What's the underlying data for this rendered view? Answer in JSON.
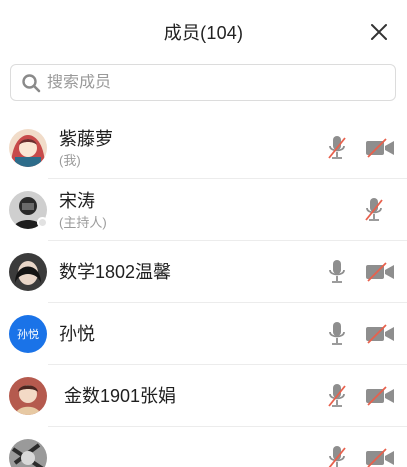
{
  "header": {
    "title": "成员(104)"
  },
  "search": {
    "placeholder": "搜索成员"
  },
  "icons": {
    "close": "close-icon",
    "search": "search-icon",
    "mic": "microphone-icon",
    "cam": "camera-icon"
  },
  "colors": {
    "muted_slash": "#e8604c",
    "icon_gray": "#8e8e8e",
    "text_avatar_bg": "#1a73e8"
  },
  "members": [
    {
      "name": "紫藤萝",
      "tag": "(我)",
      "mic_muted": true,
      "cam_off": true
    },
    {
      "name": "宋涛",
      "tag": "(主持人)",
      "mic_muted": true,
      "cam_off": null
    },
    {
      "name": "数学1802温馨",
      "tag": "",
      "mic_muted": false,
      "cam_off": true
    },
    {
      "name": "孙悦",
      "tag": "",
      "avatar_text": "孙悦",
      "mic_muted": false,
      "cam_off": true
    },
    {
      "name": "金数1901张娟",
      "tag": "",
      "mic_muted": true,
      "cam_off": true
    },
    {
      "name": "",
      "tag": "",
      "mic_muted": true,
      "cam_off": true
    }
  ]
}
